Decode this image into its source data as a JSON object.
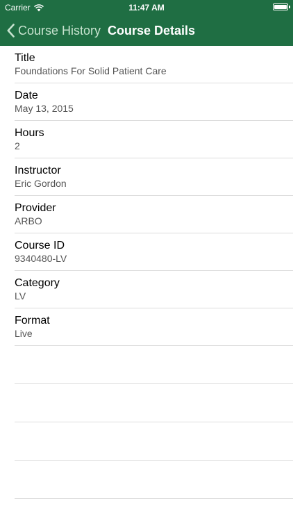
{
  "status_bar": {
    "carrier": "Carrier",
    "time": "11:47 AM",
    "wifi_icon": "wifi-icon",
    "battery_icon": "battery-icon"
  },
  "nav": {
    "back_label": "Course History",
    "title": "Course Details",
    "back_icon": "chevron-left-icon"
  },
  "colors": {
    "header_bg": "#1f6e43",
    "back_tint": "#c7e3cf"
  },
  "details": [
    {
      "label": "Title",
      "value": "Foundations For Solid Patient Care"
    },
    {
      "label": "Date",
      "value": "May 13, 2015"
    },
    {
      "label": "Hours",
      "value": "2"
    },
    {
      "label": "Instructor",
      "value": "Eric Gordon"
    },
    {
      "label": "Provider",
      "value": "ARBO"
    },
    {
      "label": "Course ID",
      "value": "9340480-LV"
    },
    {
      "label": "Category",
      "value": "LV"
    },
    {
      "label": "Format",
      "value": "Live"
    }
  ]
}
